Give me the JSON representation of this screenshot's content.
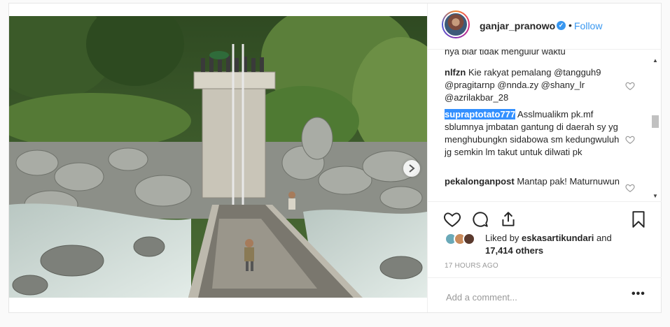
{
  "post": {
    "author": {
      "username": "ganjar_pranowo",
      "verified_icon": "verified-check-icon",
      "separator": "•",
      "follow_label": "Follow"
    },
    "photo": {
      "next_icon": "chevron-right-icon"
    },
    "comments": [
      {
        "partial_text": "nya biar tidak mengulur waktu"
      },
      {
        "user": "nlfzn",
        "text": "Kie rakyat pemalang @tangguh9 @pragitarnp @nnda.zy @shany_lr @azrilakbar_28"
      },
      {
        "user": "supraptotato777",
        "text": "Asslmualikm pk.mf sblumnya jmbatan gantung di daerah sy yg menghubungkn sidabowa sm kedungwuluh jg semkin lm takut untuk dilwati pk"
      },
      {
        "user": "pekalonganpost",
        "text": "Mantap pak! Maturnuwun"
      }
    ],
    "likes": {
      "prefix": "Liked by ",
      "liked_by_user": "eskasartikundari",
      "conjunction": " and ",
      "others": "17,414 others"
    },
    "timestamp": "17 HOURS AGO",
    "add_comment_placeholder": "Add a comment...",
    "more_label": "•••",
    "colors": {
      "link": "#3897f0",
      "text": "#262626",
      "muted": "#999999",
      "selection": "#3390ff"
    }
  }
}
